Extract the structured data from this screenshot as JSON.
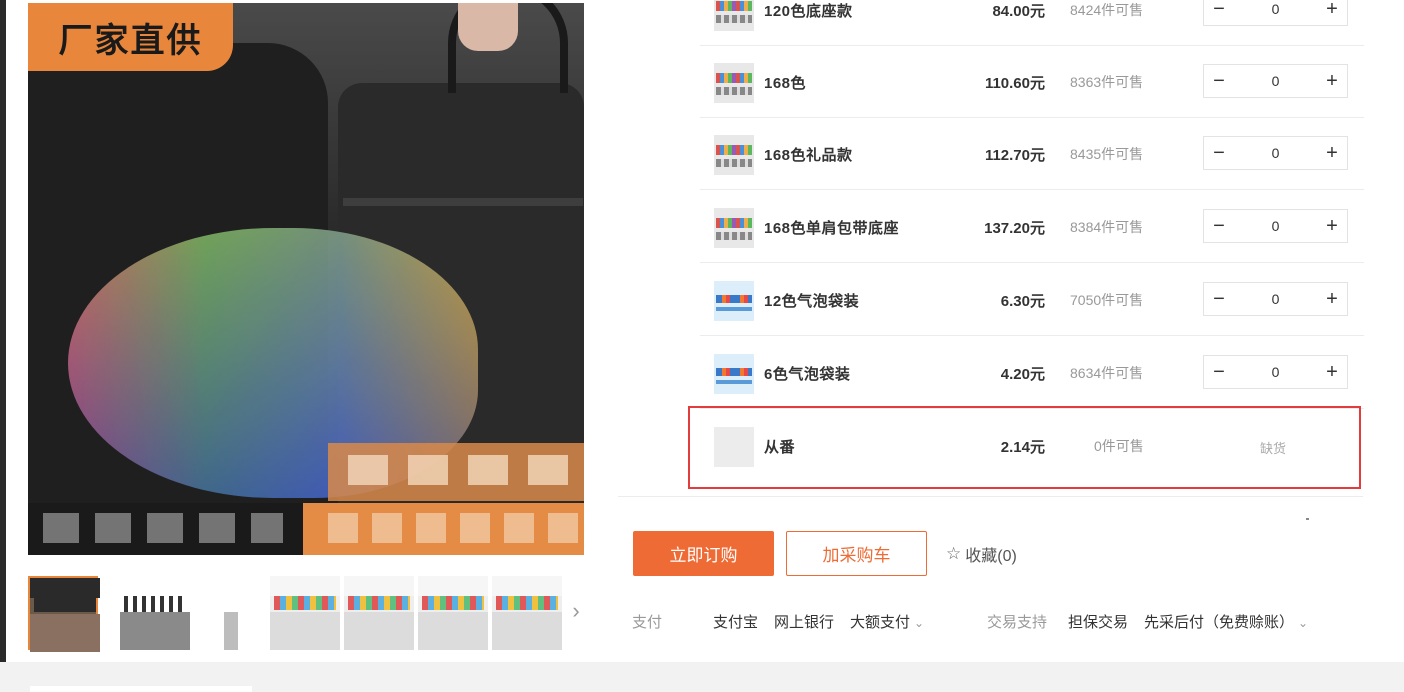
{
  "gallery": {
    "badge_text": "厂家直供",
    "next_arrow": "›"
  },
  "skus": [
    {
      "name": "120色底座款",
      "price": "84.00元",
      "stock": "8424件可售",
      "qty": "0",
      "thumb": "color"
    },
    {
      "name": "168色",
      "price": "110.60元",
      "stock": "8363件可售",
      "qty": "0",
      "thumb": "color"
    },
    {
      "name": "168色礼品款",
      "price": "112.70元",
      "stock": "8435件可售",
      "qty": "0",
      "thumb": "color"
    },
    {
      "name": "168色单肩包带底座",
      "price": "137.20元",
      "stock": "8384件可售",
      "qty": "0",
      "thumb": "color"
    },
    {
      "name": "12色气泡袋装",
      "price": "6.30元",
      "stock": "7050件可售",
      "qty": "0",
      "thumb": "blue"
    },
    {
      "name": "6色气泡袋装",
      "price": "4.20元",
      "stock": "8634件可售",
      "qty": "0",
      "thumb": "blue"
    },
    {
      "name": "从番",
      "price": "2.14元",
      "stock": "0件可售",
      "status": "缺货",
      "thumb": "plain"
    }
  ],
  "stepper": {
    "minus": "−",
    "plus": "+"
  },
  "actions": {
    "buy_now": "立即订购",
    "add_cart": "加采购车",
    "favorite": "收藏(0)"
  },
  "payment": {
    "label": "支付",
    "methods": [
      "支付宝",
      "网上银行",
      "大额支付"
    ],
    "trade_label": "交易支持",
    "trade_items": [
      "担保交易",
      "先采后付（免费赊账）"
    ],
    "caret": "⌄"
  },
  "colors": {
    "accent": "#ee6b35",
    "badge": "#e8873c",
    "highlight_border": "#e23c3c"
  }
}
